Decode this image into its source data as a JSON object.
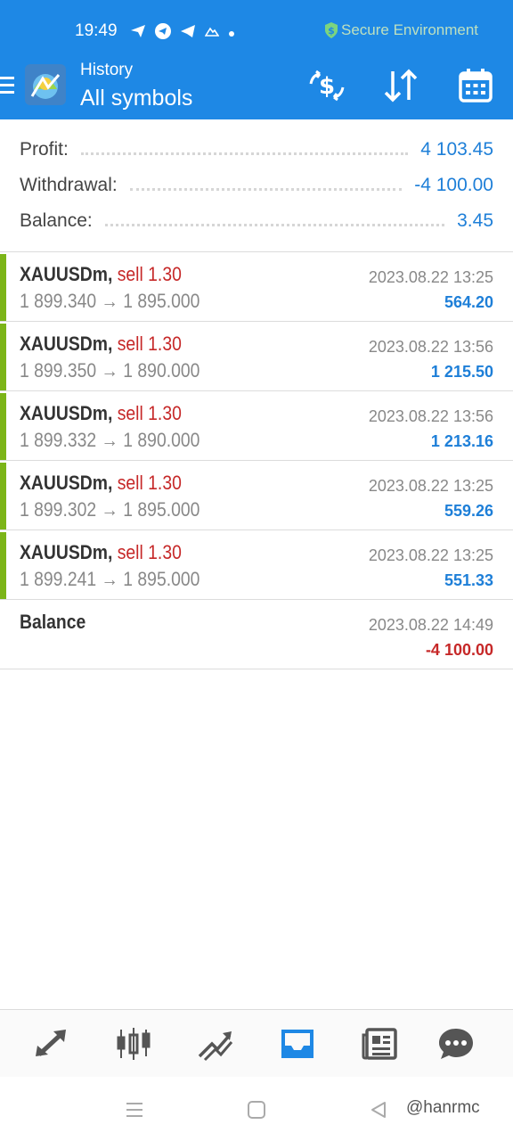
{
  "status_bar": {
    "time": "19:49",
    "secure_label": "Secure Environment"
  },
  "header": {
    "subtitle": "History",
    "title": "All symbols"
  },
  "summary": {
    "profit_label": "Profit:",
    "profit_value": "4 103.45",
    "withdrawal_label": "Withdrawal:",
    "withdrawal_value": "-4 100.00",
    "balance_label": "Balance:",
    "balance_value": "3.45"
  },
  "deals": [
    {
      "symbol": "XAUUSDm,",
      "side": "sell 1.30",
      "open": "1 899.340",
      "close": "1 895.000",
      "date": "2023.08.22 13:25",
      "profit": "564.20"
    },
    {
      "symbol": "XAUUSDm,",
      "side": "sell 1.30",
      "open": "1 899.350",
      "close": "1 890.000",
      "date": "2023.08.22 13:56",
      "profit": "1 215.50"
    },
    {
      "symbol": "XAUUSDm,",
      "side": "sell 1.30",
      "open": "1 899.332",
      "close": "1 890.000",
      "date": "2023.08.22 13:56",
      "profit": "1 213.16"
    },
    {
      "symbol": "XAUUSDm,",
      "side": "sell 1.30",
      "open": "1 899.302",
      "close": "1 895.000",
      "date": "2023.08.22 13:25",
      "profit": "559.26"
    },
    {
      "symbol": "XAUUSDm,",
      "side": "sell 1.30",
      "open": "1 899.241",
      "close": "1 895.000",
      "date": "2023.08.22 13:25",
      "profit": "551.33"
    }
  ],
  "balance_op": {
    "label": "Balance",
    "date": "2023.08.22 14:49",
    "amount": "-4 100.00"
  },
  "arrow": "→",
  "watermark": "@hanrmc",
  "colors": {
    "header_blue": "#1e88e5",
    "value_blue": "#1e7fd8",
    "sell_red": "#c62828",
    "deal_bar_green": "#7cb518"
  },
  "icons": {
    "app_logo": "metatrader-logo",
    "header_actions": [
      "currency-exchange-icon",
      "sort-icon",
      "calendar-icon"
    ],
    "bottom_nav": [
      "quotes-icon",
      "chart-icon",
      "trade-icon",
      "history-icon",
      "news-icon",
      "chat-icon"
    ],
    "active_tab": "history-icon"
  }
}
